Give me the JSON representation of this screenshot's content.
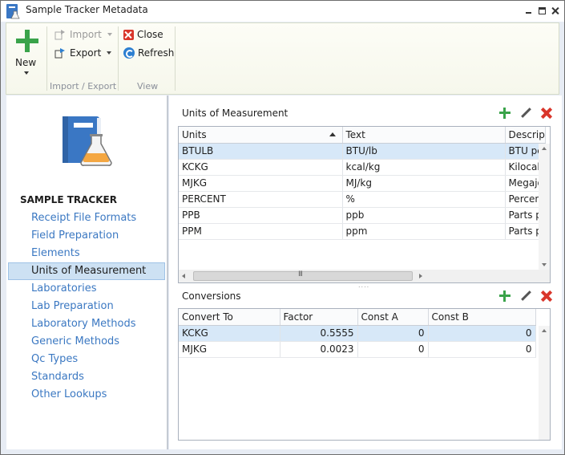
{
  "window": {
    "title": "Sample Tracker Metadata"
  },
  "ribbon": {
    "new_label": "New",
    "import_label": "Import",
    "export_label": "Export",
    "close_label": "Close",
    "refresh_label": "Refresh",
    "group_import_export": "Import / Export",
    "group_view": "View"
  },
  "nav": {
    "heading": "SAMPLE TRACKER",
    "items": [
      "Receipt File Formats",
      "Field Preparation",
      "Elements",
      "Units of Measurement",
      "Laboratories",
      "Lab Preparation",
      "Laboratory Methods",
      "Generic Methods",
      "Qc Types",
      "Standards",
      "Other Lookups"
    ],
    "active_index": 3
  },
  "units": {
    "title": "Units of Measurement",
    "columns": [
      "Units",
      "Text",
      "Descrip"
    ],
    "rows": [
      [
        "BTULB",
        "BTU/lb",
        "BTU pe"
      ],
      [
        "KCKG",
        "kcal/kg",
        "Kilocal"
      ],
      [
        "MJKG",
        "MJ/kg",
        "Megajo"
      ],
      [
        "PERCENT",
        "%",
        "Percen"
      ],
      [
        "PPB",
        "ppb",
        "Parts p"
      ],
      [
        "PPM",
        "ppm",
        "Parts p"
      ]
    ],
    "selected_row": 0,
    "hscroll_grip": "III"
  },
  "conversions": {
    "title": "Conversions",
    "columns": [
      "Convert To",
      "Factor",
      "Const A",
      "Const B"
    ],
    "rows": [
      [
        "KCKG",
        "0.5555",
        "0",
        "0"
      ],
      [
        "MJKG",
        "0.0023",
        "0",
        "0"
      ]
    ],
    "selected_row": 0
  },
  "colors": {
    "accent_green": "#3aa34a",
    "delete_red": "#d9362b",
    "nav_link": "#3b78c2",
    "selection": "#d7e8f8"
  }
}
